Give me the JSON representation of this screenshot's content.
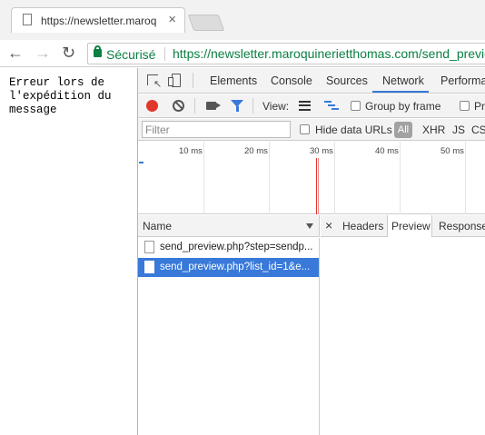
{
  "browser": {
    "tab_title": "https://newsletter.maroq",
    "tab_close": "×",
    "security_label": "Sécurisé",
    "url": "https://newsletter.maroquinerietthomas.com/send_previe",
    "url_display": "https://newsletter.maroquinerietthomas.com/send_previe"
  },
  "page": {
    "lines": [
      "Erreur lors de",
      "l'expédition du",
      "message"
    ]
  },
  "devtools": {
    "tabs": [
      "Elements",
      "Console",
      "Sources",
      "Network",
      "Performa"
    ],
    "active_tab": "Network",
    "toolbar": {
      "view_label": "View:",
      "group_by_frame": "Group by frame",
      "preserve_partial": "Pr"
    },
    "filter": {
      "placeholder": "Filter",
      "hide_data_urls": "Hide data URLs",
      "types": [
        "All",
        "XHR",
        "JS",
        "CSS"
      ]
    },
    "timeline": {
      "ticks": [
        "10 ms",
        "20 ms",
        "30 ms",
        "40 ms",
        "50 ms"
      ]
    },
    "requests": {
      "header": "Name",
      "rows": [
        {
          "name": "send_preview.php?step=sendp...",
          "selected": false
        },
        {
          "name": "send_preview.php?list_id=1&e...",
          "selected": true
        }
      ]
    },
    "detail": {
      "close": "×",
      "tabs": [
        "Headers",
        "Preview",
        "Response"
      ],
      "active_tab": "Preview"
    }
  },
  "colors": {
    "accent": "#3879d9",
    "secure_green": "#0b8043",
    "record_red": "#e0362c"
  }
}
